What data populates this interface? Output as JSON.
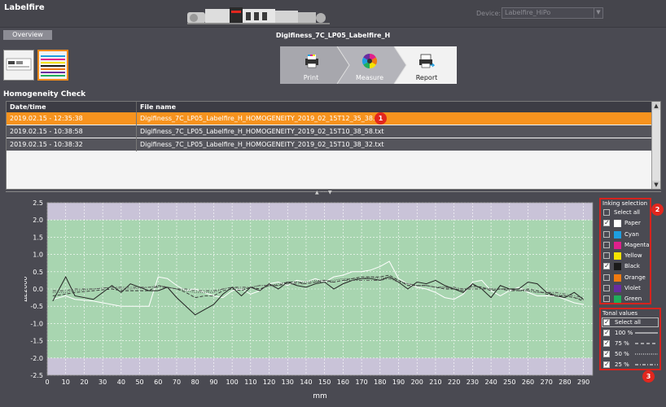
{
  "app": {
    "title": "Labelfire"
  },
  "device": {
    "label": "Device:",
    "value": "Labelfire_HiPo"
  },
  "subbar": {
    "overview_tab": "Overview",
    "document_title": "Digifiness_7C_LP05_Labelfire_H"
  },
  "workflow": {
    "steps": [
      "Print",
      "Measure",
      "Report"
    ]
  },
  "section": {
    "title": "Homogeneity Check"
  },
  "table": {
    "columns": [
      "Date/time",
      "File name"
    ],
    "rows": [
      {
        "date": "2019.02.15 - 12:35:38",
        "file": "Digifiness_7C_LP05_Labelfire_H_HOMOGENEITY_2019_02_15T12_35_38.txt"
      },
      {
        "date": "2019.02.15 - 10:38:58",
        "file": "Digifiness_7C_LP05_Labelfire_H_HOMOGENEITY_2019_02_15T10_38_58.txt"
      },
      {
        "date": "2019.02.15 - 10:38:32",
        "file": "Digifiness_7C_LP05_Labelfire_H_HOMOGENEITY_2019_02_15T10_38_32.txt"
      }
    ]
  },
  "badges": [
    "1",
    "2",
    "3"
  ],
  "inking": {
    "title": "Inking selection",
    "items": [
      {
        "label": "Select all",
        "checked": false,
        "color": ""
      },
      {
        "label": "Paper",
        "checked": true,
        "color": "#ffffff"
      },
      {
        "label": "Cyan",
        "checked": false,
        "color": "#1e9fe0"
      },
      {
        "label": "Magenta",
        "checked": false,
        "color": "#e0208c"
      },
      {
        "label": "Yellow",
        "checked": false,
        "color": "#f5e400"
      },
      {
        "label": "Black",
        "checked": true,
        "color": "#1a1a1a"
      },
      {
        "label": "Orange",
        "checked": false,
        "color": "#f07a10"
      },
      {
        "label": "Violet",
        "checked": false,
        "color": "#6a2ca0"
      },
      {
        "label": "Green",
        "checked": false,
        "color": "#1fae5c"
      }
    ]
  },
  "tonal": {
    "title": "Tonal values",
    "items": [
      {
        "label": "Select all",
        "checked": true,
        "style": ""
      },
      {
        "label": "100 %",
        "checked": true,
        "style": "solid"
      },
      {
        "label": "75 %",
        "checked": true,
        "style": "dashed"
      },
      {
        "label": "50 %",
        "checked": true,
        "style": "dotted"
      },
      {
        "label": "25 %",
        "checked": true,
        "style": "dashdot"
      }
    ]
  },
  "chart_data": {
    "type": "line",
    "xlabel": "mm",
    "ylabel": "ΔE2000",
    "xlim": [
      0,
      295
    ],
    "ylim": [
      -2.5,
      2.5
    ],
    "xticks": [
      0,
      10,
      20,
      30,
      40,
      50,
      60,
      70,
      80,
      90,
      100,
      110,
      120,
      130,
      140,
      150,
      160,
      170,
      180,
      190,
      200,
      210,
      220,
      230,
      240,
      250,
      260,
      270,
      280,
      290
    ],
    "yticks": [
      2.5,
      2.0,
      1.5,
      1.0,
      0.5,
      0.0,
      -0.5,
      -1.0,
      -1.5,
      -2.0,
      -2.5
    ],
    "tolerance_band": [
      -2.0,
      2.0
    ],
    "x": [
      3,
      10,
      15,
      25,
      35,
      40,
      45,
      55,
      60,
      65,
      70,
      75,
      80,
      85,
      90,
      95,
      100,
      105,
      110,
      115,
      120,
      125,
      130,
      135,
      140,
      145,
      150,
      155,
      160,
      165,
      170,
      175,
      180,
      185,
      190,
      195,
      200,
      205,
      210,
      215,
      220,
      225,
      230,
      235,
      240,
      245,
      250,
      255,
      260,
      265,
      270,
      275,
      280,
      285,
      290
    ],
    "series": [
      {
        "name": "Paper",
        "color": "#ffffff",
        "style": "solid",
        "values": [
          -0.3,
          -0.2,
          -0.3,
          -0.35,
          -0.45,
          -0.5,
          -0.5,
          -0.5,
          0.35,
          0.3,
          0.1,
          -0.05,
          0.0,
          -0.1,
          -0.2,
          -0.25,
          -0.05,
          0.0,
          -0.15,
          -0.05,
          0.15,
          0.2,
          0.1,
          0.25,
          0.2,
          0.3,
          0.2,
          0.35,
          0.4,
          0.5,
          0.5,
          0.55,
          0.65,
          0.8,
          0.3,
          0.15,
          0.05,
          0.0,
          -0.1,
          -0.25,
          -0.3,
          -0.15,
          0.2,
          0.25,
          -0.05,
          -0.2,
          -0.05,
          0.05,
          -0.1,
          -0.2,
          -0.2,
          -0.2,
          -0.3,
          -0.4,
          -0.45
        ]
      },
      {
        "name": "Black",
        "color": "#222222",
        "style": "solid",
        "values": [
          -0.35,
          0.35,
          -0.2,
          -0.3,
          0.1,
          -0.1,
          0.15,
          -0.05,
          -0.05,
          0.05,
          -0.25,
          -0.5,
          -0.75,
          -0.6,
          -0.45,
          -0.15,
          0.05,
          -0.2,
          0.05,
          -0.05,
          0.15,
          0.0,
          0.2,
          0.1,
          0.05,
          0.15,
          0.2,
          0.0,
          0.15,
          0.25,
          0.3,
          0.3,
          0.25,
          0.35,
          0.2,
          0.0,
          0.2,
          0.15,
          0.25,
          0.1,
          0.0,
          -0.1,
          0.15,
          0.0,
          -0.25,
          0.1,
          0.0,
          0.0,
          0.2,
          0.15,
          -0.1,
          -0.2,
          -0.25,
          -0.1,
          -0.3
        ]
      },
      {
        "name": "Black 75 %",
        "color": "#333333",
        "style": "dashed",
        "values": [
          -0.2,
          -0.15,
          -0.1,
          -0.05,
          0.0,
          -0.05,
          -0.05,
          -0.05,
          0.1,
          0.05,
          0.0,
          -0.1,
          -0.25,
          -0.2,
          -0.2,
          -0.05,
          0.0,
          -0.05,
          0.05,
          0.0,
          0.1,
          0.1,
          0.2,
          0.2,
          0.15,
          0.2,
          0.25,
          0.2,
          0.25,
          0.3,
          0.35,
          0.35,
          0.35,
          0.4,
          0.25,
          0.1,
          0.1,
          0.1,
          0.05,
          0.0,
          0.0,
          -0.05,
          0.1,
          0.05,
          -0.05,
          0.0,
          0.0,
          -0.05,
          0.0,
          -0.05,
          -0.15,
          -0.2,
          -0.2,
          -0.25,
          -0.35
        ]
      },
      {
        "name": "Black 50 %",
        "color": "#444444",
        "style": "dotted",
        "values": [
          -0.1,
          -0.1,
          -0.05,
          0.0,
          0.05,
          0.0,
          0.0,
          0.05,
          0.1,
          0.05,
          0.0,
          -0.05,
          -0.1,
          -0.1,
          -0.1,
          0.0,
          0.05,
          0.0,
          0.05,
          0.1,
          0.1,
          0.15,
          0.2,
          0.2,
          0.2,
          0.25,
          0.25,
          0.25,
          0.3,
          0.3,
          0.3,
          0.35,
          0.3,
          0.35,
          0.25,
          0.15,
          0.1,
          0.1,
          0.05,
          0.05,
          0.0,
          0.0,
          0.05,
          0.05,
          0.0,
          0.0,
          0.0,
          -0.05,
          -0.05,
          -0.1,
          -0.1,
          -0.15,
          -0.2,
          -0.25,
          -0.3
        ]
      },
      {
        "name": "Black 25 %",
        "color": "#555555",
        "style": "dashdot",
        "values": [
          -0.05,
          -0.05,
          0.0,
          0.0,
          0.05,
          0.05,
          0.05,
          0.05,
          0.05,
          0.05,
          0.0,
          0.0,
          -0.05,
          -0.05,
          -0.05,
          0.0,
          0.05,
          0.05,
          0.05,
          0.1,
          0.1,
          0.1,
          0.15,
          0.15,
          0.15,
          0.2,
          0.2,
          0.2,
          0.25,
          0.25,
          0.25,
          0.25,
          0.25,
          0.3,
          0.2,
          0.15,
          0.1,
          0.1,
          0.05,
          0.05,
          0.05,
          0.0,
          0.0,
          0.0,
          0.0,
          0.0,
          -0.05,
          -0.05,
          -0.05,
          -0.1,
          -0.1,
          -0.1,
          -0.15,
          -0.2,
          -0.25
        ]
      }
    ]
  }
}
